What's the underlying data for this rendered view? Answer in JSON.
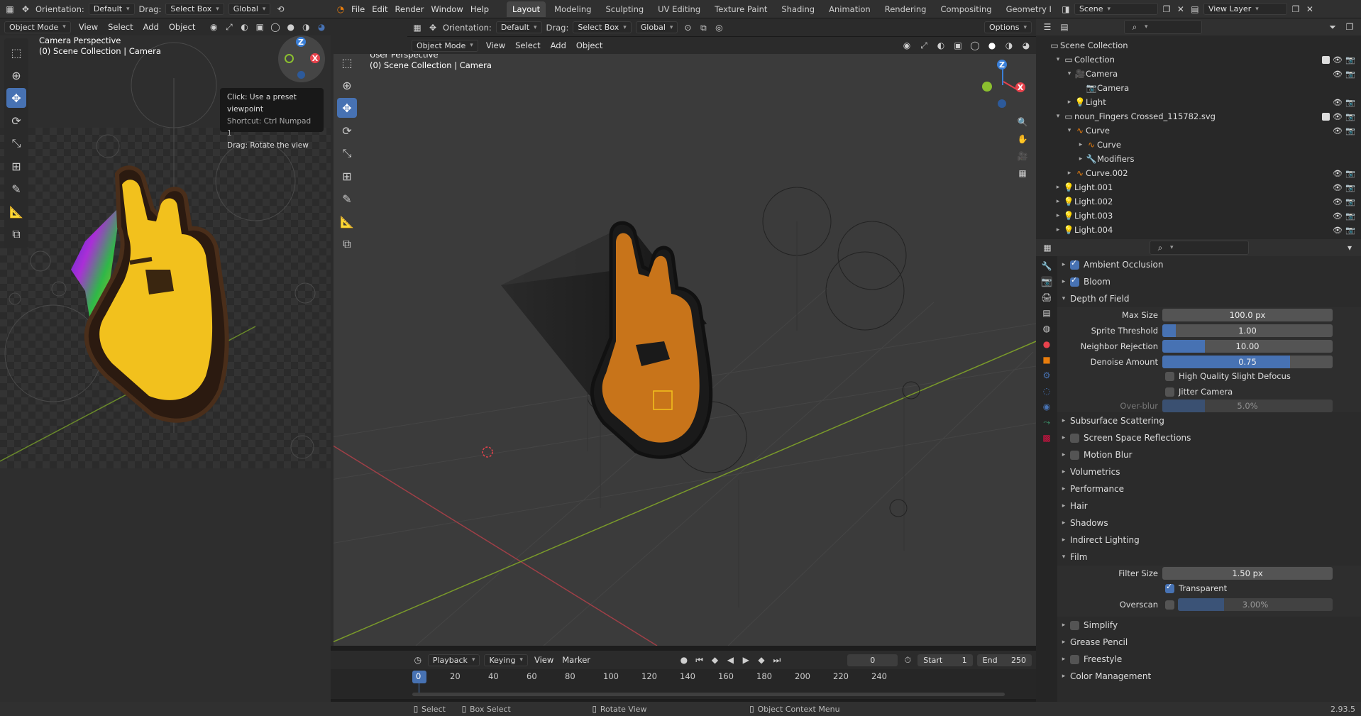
{
  "top_left": {
    "orientation_label": "Orientation:",
    "orientation_value": "Default",
    "drag_label": "Drag:",
    "drag_value": "Select Box",
    "transform_value": "Global"
  },
  "menu": [
    "File",
    "Edit",
    "Render",
    "Window",
    "Help"
  ],
  "workspace_tabs": [
    "Layout",
    "Modeling",
    "Sculpting",
    "UV Editing",
    "Texture Paint",
    "Shading",
    "Animation",
    "Rendering",
    "Compositing",
    "Geometry I"
  ],
  "active_tab_index": 0,
  "scene": {
    "value": "Scene"
  },
  "view_layer": {
    "value": "View Layer"
  },
  "left_viewport": {
    "mode": "Object Mode",
    "menus": [
      "View",
      "Select",
      "Add",
      "Object"
    ],
    "title": "Camera Perspective",
    "subtitle": "(0) Scene Collection | Camera",
    "tooltip": [
      "Click: Use a preset viewpoint",
      "Shortcut: Ctrl Numpad 1",
      "Drag: Rotate the view"
    ]
  },
  "main_viewport": {
    "orientation_label": "Orientation:",
    "orientation_value": "Default",
    "drag_label": "Drag:",
    "drag_value": "Select Box",
    "transform_value": "Global",
    "options": "Options",
    "mode": "Object Mode",
    "menus": [
      "View",
      "Select",
      "Add",
      "Object"
    ],
    "title": "User Perspective",
    "subtitle": "(0) Scene Collection | Camera",
    "axis_labels": {
      "z": "Z",
      "x": "X"
    }
  },
  "outliner": {
    "root": "Scene Collection",
    "rows": [
      {
        "label": "Collection",
        "indent": 1,
        "icon": "collection-icon",
        "tri": "▾",
        "checks": true
      },
      {
        "label": "Camera",
        "indent": 2,
        "icon": "camera-object-icon",
        "tri": "▾",
        "checks": true
      },
      {
        "label": "Camera",
        "indent": 3,
        "icon": "camera-data-icon",
        "tri": "",
        "checks": false
      },
      {
        "label": "Light",
        "indent": 2,
        "icon": "light-icon",
        "tri": "▸",
        "checks": true
      },
      {
        "label": "noun_Fingers Crossed_115782.svg",
        "indent": 1,
        "icon": "collection-icon",
        "tri": "▾",
        "checks": true
      },
      {
        "label": "Curve",
        "indent": 2,
        "icon": "curve-object-icon",
        "tri": "▾",
        "checks": true
      },
      {
        "label": "Curve",
        "indent": 3,
        "icon": "curve-data-icon",
        "tri": "▸",
        "checks": false
      },
      {
        "label": "Modifiers",
        "indent": 3,
        "icon": "wrench-icon",
        "tri": "▸",
        "checks": false
      },
      {
        "label": "Curve.002",
        "indent": 2,
        "icon": "curve-object-icon",
        "tri": "▸",
        "checks": true
      },
      {
        "label": "Light.001",
        "indent": 1,
        "icon": "light-icon",
        "tri": "▸",
        "checks": true
      },
      {
        "label": "Light.002",
        "indent": 1,
        "icon": "light-icon",
        "tri": "▸",
        "checks": true
      },
      {
        "label": "Light.003",
        "indent": 1,
        "icon": "light-icon",
        "tri": "▸",
        "checks": true
      },
      {
        "label": "Light.004",
        "indent": 1,
        "icon": "light-icon",
        "tri": "▸",
        "checks": true
      }
    ]
  },
  "properties": {
    "ambient_occlusion": "Ambient Occlusion",
    "bloom": "Bloom",
    "depth_of_field": "Depth of Field",
    "max_size_label": "Max Size",
    "max_size": "100.0 px",
    "sprite_threshold_label": "Sprite Threshold",
    "sprite_threshold": "1.00",
    "sprite_threshold_fill": 0.08,
    "neighbor_rejection_label": "Neighbor Rejection",
    "neighbor_rejection": "10.00",
    "neighbor_rejection_fill": 0.25,
    "denoise_amount_label": "Denoise Amount",
    "denoise_amount": "0.75",
    "denoise_amount_fill": 0.75,
    "hq_defocus": "High Quality Slight Defocus",
    "jitter_camera": "Jitter Camera",
    "overblur_label": "Over-blur",
    "overblur": "5.0%",
    "overblur_fill": 0.25,
    "sections": [
      "Subsurface Scattering",
      "Screen Space Reflections",
      "Motion Blur",
      "Volumetrics",
      "Performance",
      "Hair",
      "Shadows",
      "Indirect Lighting"
    ],
    "film": "Film",
    "filter_size_label": "Filter Size",
    "filter_size": "1.50 px",
    "transparent": "Transparent",
    "overscan_label": "Overscan",
    "overscan": "3.00%",
    "overscan_fill": 0.3,
    "sections2": [
      "Simplify",
      "Grease Pencil",
      "Freestyle",
      "Color Management"
    ]
  },
  "timeline": {
    "menus": [
      "Playback",
      "Keying",
      "View",
      "Marker"
    ],
    "current_frame": "0",
    "start_label": "Start",
    "start": "1",
    "end_label": "End",
    "end": "250",
    "ticks": [
      "0",
      "20",
      "40",
      "60",
      "80",
      "100",
      "120",
      "140",
      "160",
      "180",
      "200",
      "220",
      "240"
    ]
  },
  "status": {
    "select": "Select",
    "box_select": "Box Select",
    "rotate_view": "Rotate View",
    "context_menu": "Object Context Menu",
    "version": "2.93.5"
  },
  "colors": {
    "accent": "#4772b3",
    "x_axis": "#e8424c",
    "y_axis": "#8bbf2f",
    "z_axis": "#3a7fd8",
    "hand_orange": "#c8741a",
    "hand_yellow": "#f2c11d"
  }
}
